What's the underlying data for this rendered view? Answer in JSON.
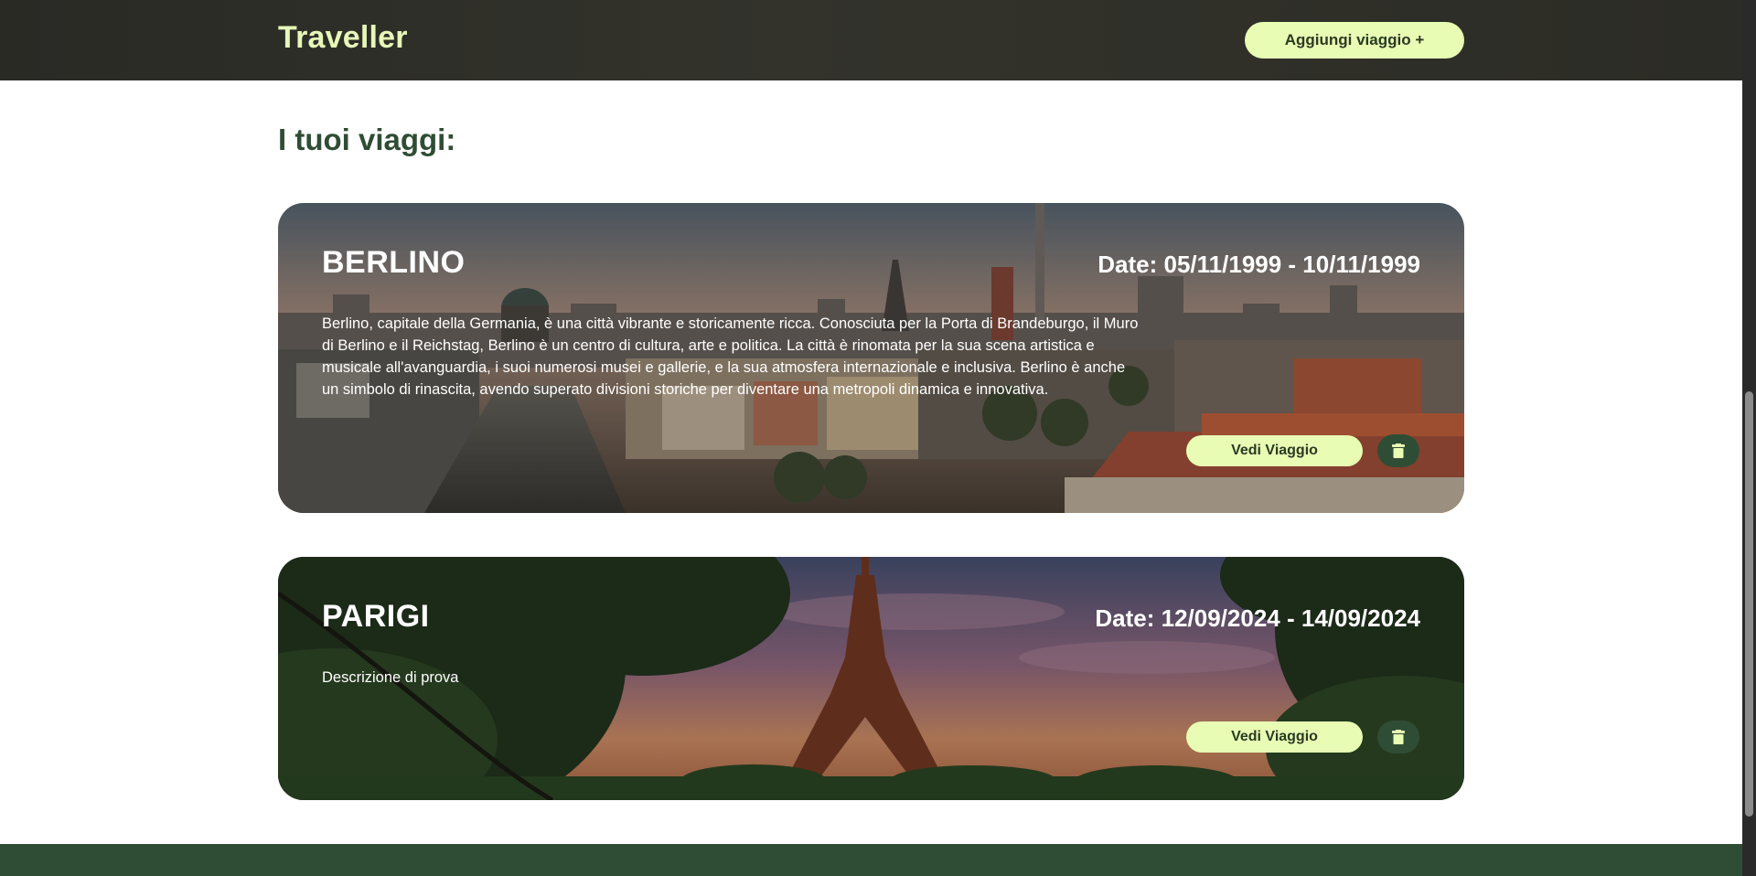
{
  "header": {
    "logo": "Traveller",
    "add_button_label": "Aggiungi viaggio +"
  },
  "page_title": "I tuoi viaggi:",
  "trips": [
    {
      "city": "BERLINO",
      "dates": "Date: 05/11/1999 - 10/11/1999",
      "description": "Berlino, capitale della Germania, è una città vibrante e storicamente ricca. Conosciuta per la Porta di Brandeburgo, il Muro di Berlino e il Reichstag, Berlino è un centro di cultura, arte e politica. La città è rinomata per la sua scena artistica e musicale all'avanguardia, i suoi numerosi musei e gallerie, e la sua atmosfera internazionale e inclusiva. Berlino è anche un simbolo di rinascita, avendo superato divisioni storiche per diventare una metropoli dinamica e innovativa.",
      "view_label": "Vedi Viaggio",
      "delete_icon": "trash-icon"
    },
    {
      "city": "PARIGI",
      "dates": "Date: 12/09/2024 - 14/09/2024",
      "description": "Descrizione di prova",
      "view_label": "Vedi Viaggio",
      "delete_icon": "trash-icon"
    }
  ],
  "colors": {
    "header_bg": "#2c2c26",
    "accent_light": "#e8fcb4",
    "accent_dark": "#2f4d35",
    "title_green": "#2f4d35"
  }
}
